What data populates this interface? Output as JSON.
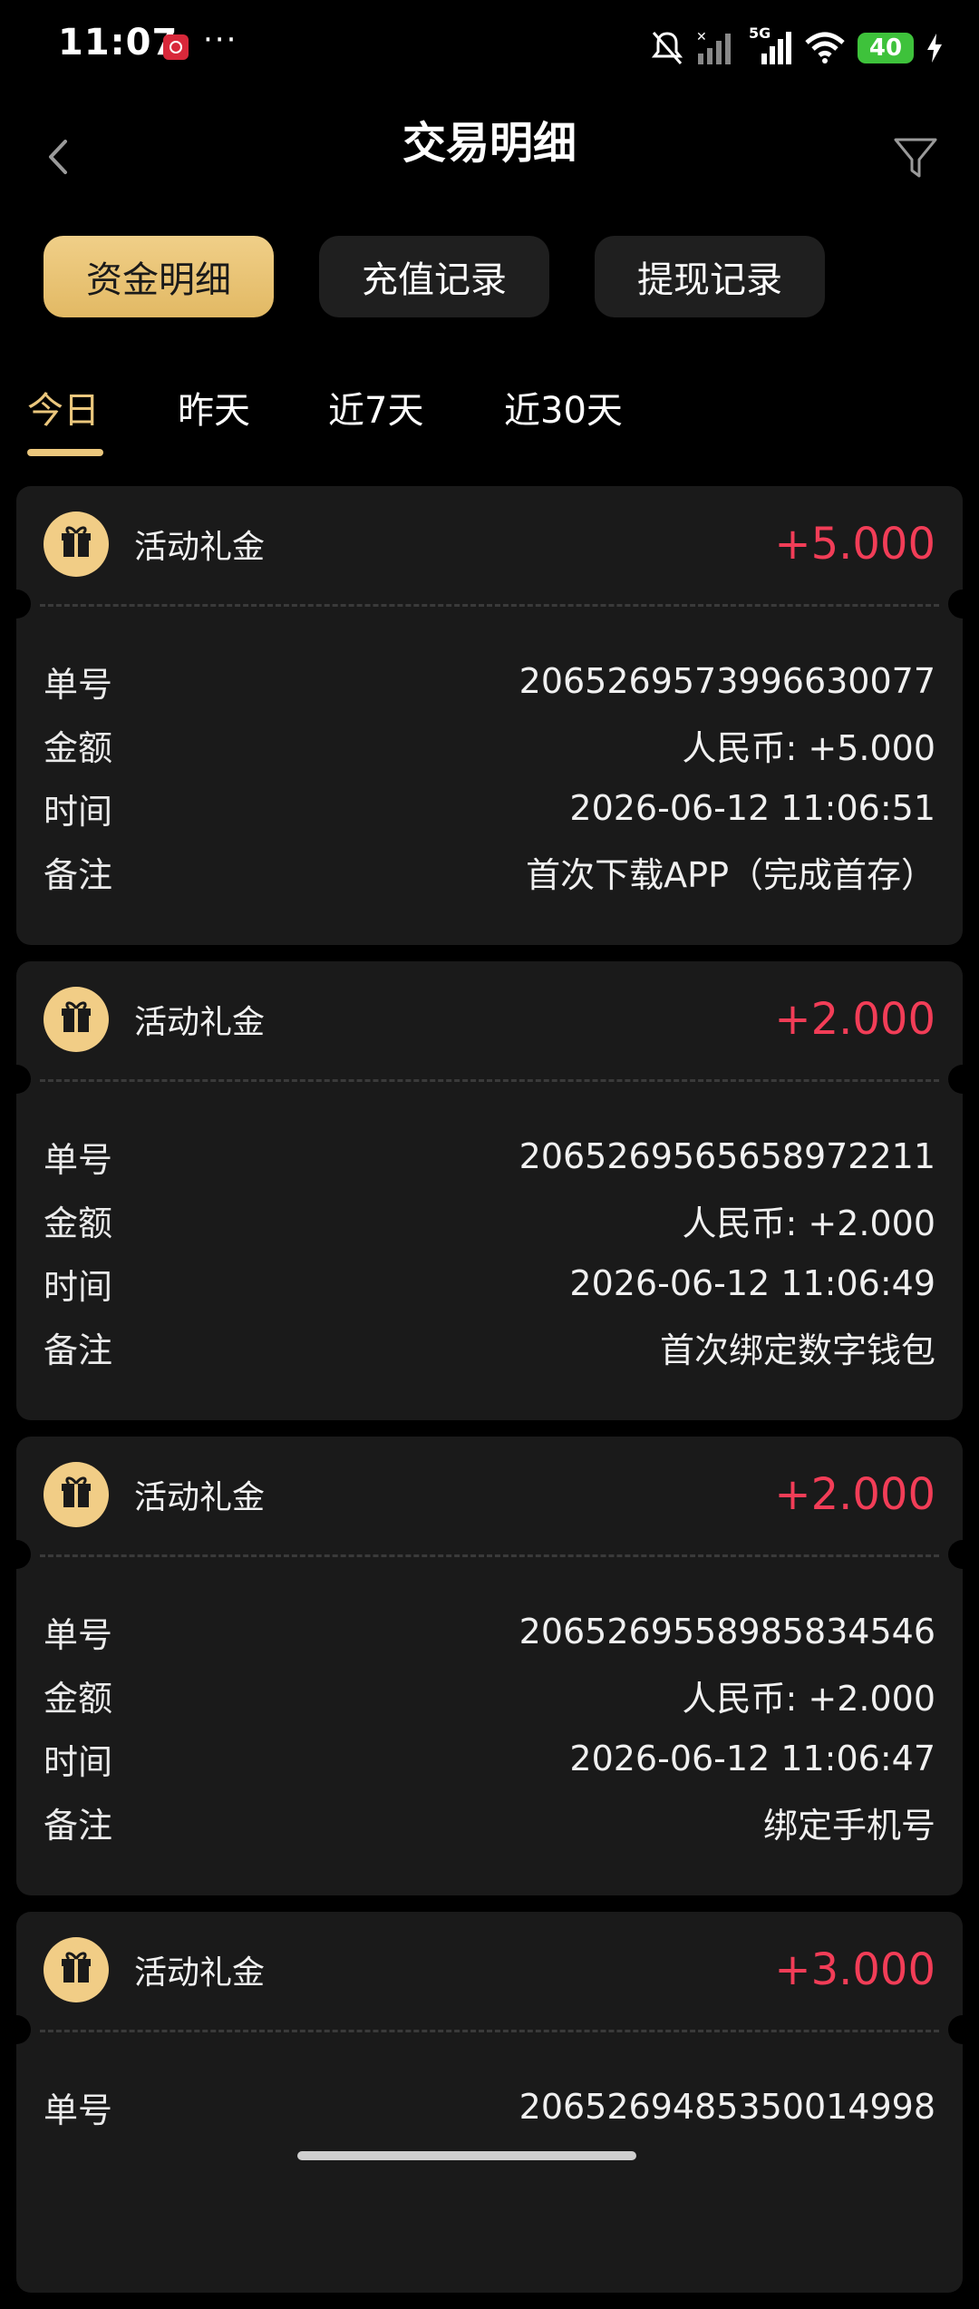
{
  "status_bar": {
    "time": "11:07",
    "more": "···",
    "network": "5G",
    "battery": "40",
    "icons": [
      "app-notification-icon",
      "mute-icon",
      "signal-icon",
      "signal-5g-icon",
      "wifi-icon",
      "battery-icon",
      "charging-icon"
    ]
  },
  "header": {
    "title": "交易明细",
    "back_icon": "chevron-left-icon",
    "filter_icon": "filter-icon"
  },
  "segments": [
    "资金明细",
    "充值记录",
    "提现记录"
  ],
  "tabs": [
    "今日",
    "昨天",
    "近7天",
    "近30天"
  ],
  "field_labels": {
    "order": "单号",
    "amount": "金额",
    "time": "时间",
    "note": "备注"
  },
  "records": [
    {
      "type": "活动礼金",
      "amount": "+5.000",
      "order_no": "2065269573996630077",
      "amount_detail": "人民币: +5.000",
      "time": "2026-06-12 11:06:51",
      "note": "首次下载APP（完成首存）"
    },
    {
      "type": "活动礼金",
      "amount": "+2.000",
      "order_no": "2065269565658972211",
      "amount_detail": "人民币: +2.000",
      "time": "2026-06-12 11:06:49",
      "note": "首次绑定数字钱包"
    },
    {
      "type": "活动礼金",
      "amount": "+2.000",
      "order_no": "2065269558985834546",
      "amount_detail": "人民币: +2.000",
      "time": "2026-06-12 11:06:47",
      "note": "绑定手机号"
    },
    {
      "type": "活动礼金",
      "amount": "+3.000",
      "order_no": "2065269485350014998"
    }
  ],
  "colors": {
    "accent_gold": "#ebc77d",
    "positive_amount": "#f23d57",
    "card_bg": "#1a1a1a"
  }
}
